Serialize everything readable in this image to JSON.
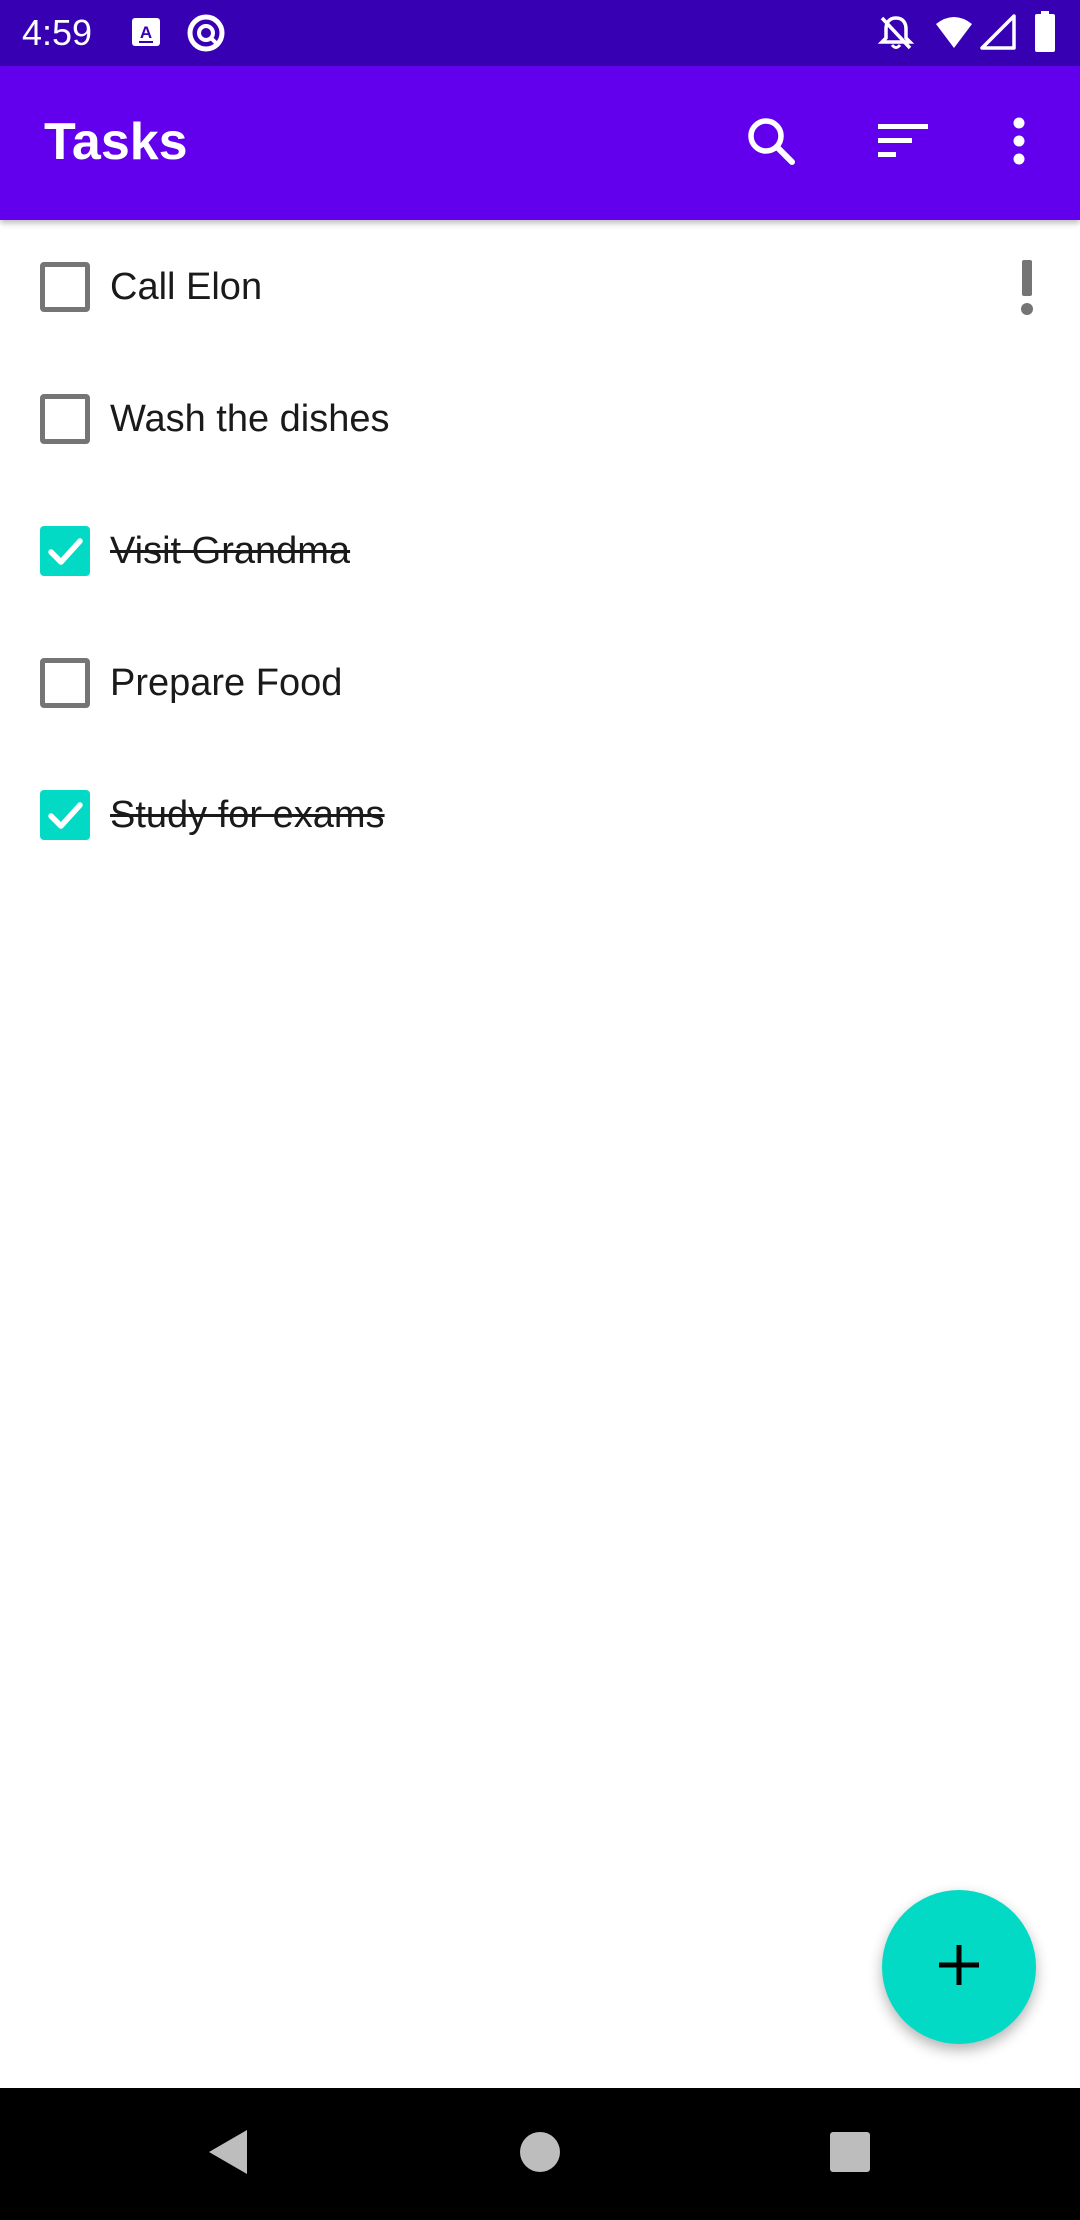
{
  "status_bar": {
    "time": "4:59",
    "icons": [
      "keyboard-a-icon",
      "at-sign-icon",
      "notifications-off-icon",
      "wifi-icon",
      "signal-icon",
      "battery-icon"
    ]
  },
  "app_bar": {
    "title": "Tasks",
    "actions": [
      "search-icon",
      "sort-icon",
      "more-vert-icon"
    ]
  },
  "tasks": [
    {
      "label": "Call Elon",
      "checked": false,
      "important": true
    },
    {
      "label": "Wash the dishes",
      "checked": false,
      "important": false
    },
    {
      "label": "Visit Grandma",
      "checked": true,
      "important": false
    },
    {
      "label": "Prepare Food",
      "checked": false,
      "important": false
    },
    {
      "label": "Study for exams",
      "checked": true,
      "important": false
    }
  ],
  "fab": {
    "icon": "add-icon"
  },
  "navigation": {
    "icons": [
      "back-icon",
      "home-icon",
      "recents-icon"
    ]
  },
  "colors": {
    "status_bar": "#3700b3",
    "app_bar": "#6200ee",
    "accent": "#03dac5",
    "checkbox_unchecked": "#757575",
    "priority": "#757575"
  }
}
